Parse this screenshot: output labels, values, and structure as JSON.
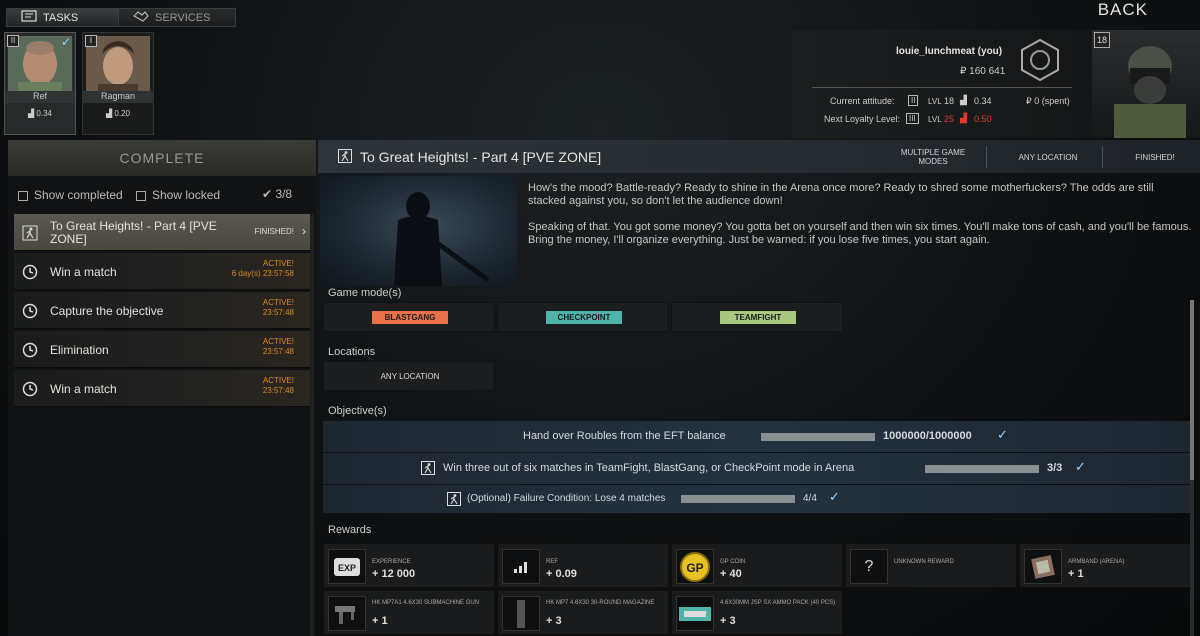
{
  "nav": {
    "tasks": "TASKS",
    "services": "SERVICES",
    "back": "BACK"
  },
  "traders": [
    {
      "name": "Ref",
      "level": "II",
      "standing": "0.34",
      "selected": true
    },
    {
      "name": "Ragman",
      "level": "I",
      "standing": "0.20",
      "selected": false
    }
  ],
  "player": {
    "name": "louie_lunchmeat (you)",
    "money": "₽ 160 641",
    "level_badge": "18",
    "current_attitude_label": "Current attitude:",
    "current_level_roman": "II",
    "current_lvl": "LVL",
    "current_lvl_value": "18",
    "current_standing": "0.34",
    "current_spent": "₽ 0 (spent)",
    "next_loyalty_label": "Next Loyalty Level:",
    "next_level_roman": "III",
    "next_lvl": "LVL",
    "next_lvl_value": "25",
    "next_standing": "0.50"
  },
  "left": {
    "status_header": "COMPLETE",
    "show_completed": "Show completed",
    "show_locked": "Show locked",
    "count": "3/8",
    "quests": [
      {
        "name": "To Great Heights! - Part 4 [PVE ZONE]",
        "status": "FINISHED!",
        "time": "",
        "icon": "runner-icon"
      },
      {
        "name": "Win a match",
        "status": "ACTIVE!",
        "time": "6 day(s) 23:57:58",
        "icon": "clock-icon"
      },
      {
        "name": "Capture the objective",
        "status": "ACTIVE!",
        "time": "23:57:48",
        "icon": "clock-icon"
      },
      {
        "name": "Elimination",
        "status": "ACTIVE!",
        "time": "23:57:48",
        "icon": "clock-icon"
      },
      {
        "name": "Win a match",
        "status": "ACTIVE!",
        "time": "23:57:48",
        "icon": "clock-icon"
      }
    ]
  },
  "quest": {
    "title": "To Great Heights! - Part 4 [PVE ZONE]",
    "mode_header": "MULTIPLE GAME MODES",
    "location_header": "ANY LOCATION",
    "status_header": "FINISHED!",
    "description": [
      "How's the mood? Battle-ready? Ready to shine in the Arena once more? Ready to shred some motherfuckers? The odds are still stacked against you, so don't let the audience down!",
      "Speaking of that. You got some money? You gotta bet on yourself and then win six times. You'll make tons of cash, and you'll be famous. Bring the money, I'll organize everything. Just be warned: if you lose five times, you start again."
    ],
    "game_modes_label": "Game mode(s)",
    "game_modes": [
      {
        "name": "BLASTGANG",
        "color": "#e8714a"
      },
      {
        "name": "CHECKPOINT",
        "color": "#4fb3a9"
      },
      {
        "name": "TEAMFIGHT",
        "color": "#a8c97f"
      }
    ],
    "locations_label": "Locations",
    "location": "ANY LOCATION",
    "objectives_label": "Objective(s)",
    "objectives": [
      {
        "text": "Hand over Roubles from the EFT balance",
        "progress": "1000000/1000000",
        "fraction": 1.0
      },
      {
        "text": "Win three out of six matches in TeamFight, BlastGang, or CheckPoint mode in Arena",
        "progress": "3/3",
        "fraction": 1.0
      },
      {
        "text": "(Optional) Failure Condition: Lose 4 matches",
        "progress": "4/4",
        "fraction": 1.0
      }
    ],
    "rewards_label": "Rewards",
    "rewards": [
      {
        "name": "EXPERIENCE",
        "value": "+ 12 000",
        "icon": "exp-icon"
      },
      {
        "name": "REF",
        "value": "+ 0.09",
        "icon": "standing-icon"
      },
      {
        "name": "GP COIN",
        "value": "+ 40",
        "icon": "gp-coin-icon"
      },
      {
        "name": "UNKNOWN REWARD",
        "value": "",
        "icon": "question-icon"
      },
      {
        "name": "ARMBAND (ARENA)",
        "value": "+ 1",
        "icon": "armband-icon"
      },
      {
        "name": "HK MP7A1 4.6X30 SUBMACHINE GUN",
        "value": "+ 1",
        "icon": "smg-icon"
      },
      {
        "name": "HK MP7 4.6X30 30-ROUND MAGAZINE",
        "value": "+ 3",
        "icon": "magazine-icon"
      },
      {
        "name": "4.6X30MM JSP SX AMMO PACK (40 PCS)",
        "value": "+ 3",
        "icon": "ammo-pack-icon"
      }
    ]
  }
}
